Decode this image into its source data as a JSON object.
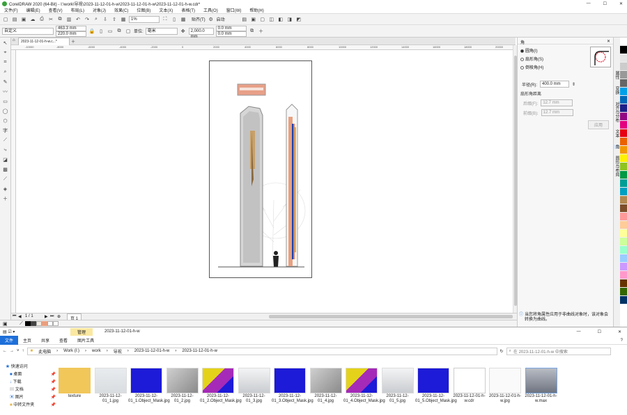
{
  "window": {
    "title": "CorelDRAW 2020 (64-Bit) - I:\\work\\导视\\2023-11-12-01-h-w\\2023-11-12-01-h-w\\2023-11-12-01-h-w.cdr*"
  },
  "menu": [
    "文件(F)",
    "编辑(E)",
    "查看(V)",
    "布局(L)",
    "对象(J)",
    "效果(C)",
    "位图(B)",
    "文本(X)",
    "表格(T)",
    "工具(O)",
    "窗口(W)",
    "帮助(H)"
  ],
  "toolbar": {
    "zoom": "1%",
    "publish": "贴齐(T)",
    "launch": "启动"
  },
  "propbar": {
    "preset": "自定义",
    "width": "463.3 mm",
    "height": "220.0 mm",
    "units_label": "单位:",
    "units": "毫米",
    "nudge": "2,000.0 mm",
    "dup_x": "0.0 mm",
    "dup_y": "0.0 mm"
  },
  "document": {
    "tab": "2023-11-12-01-h-w.c...*",
    "page_tab": "页 1"
  },
  "ruler_ticks": [
    "-10000",
    "-8000",
    "-6000",
    "-4000",
    "-2000",
    "0",
    "2000",
    "4000",
    "6000",
    "8000",
    "10000",
    "12000",
    "14000",
    "16000",
    "18000",
    "20000"
  ],
  "panel": {
    "header": "角",
    "option_round": "圆角(I)",
    "option_scallop": "扇形角(S)",
    "option_chamfer": "倒棱角(H)",
    "radius_label": "半径(R):",
    "radius_value": "400.0 mm",
    "corner_distance": "扇形角距离",
    "offset_label": "后缀(F):",
    "offset_value": "12.7 mm",
    "offset2_label": "前缀(B):",
    "offset2_value": "12.7 mm",
    "apply": "应用",
    "note": "当您将角属性应用于非曲线对象时，该对象会转换为曲线。"
  },
  "right_tabs": [
    "属性",
    "变换",
    "对齐与分布",
    "文本",
    "角",
    "图形与布局"
  ],
  "palette_colors": [
    "#ffffff",
    "#000000",
    "#e5e5e5",
    "#cccccc",
    "#999999",
    "#666666",
    "#00a0e9",
    "#0068b7",
    "#1d2088",
    "#920783",
    "#e4007f",
    "#e60012",
    "#eb6100",
    "#f39800",
    "#fff100",
    "#8fc31f",
    "#009944",
    "#009e96",
    "#00a0c1",
    "#b28850",
    "#7d4e2a",
    "#ff9999",
    "#ffcc99",
    "#ffff99",
    "#ccff99",
    "#99ffcc",
    "#99ccff",
    "#cc99ff",
    "#ff99cc",
    "#663300",
    "#336600",
    "#003366"
  ],
  "explorer": {
    "ribbon_tabs": [
      "文件",
      "主页",
      "共享",
      "查看"
    ],
    "manage_tab": "管理",
    "picture_tools": "图片工具",
    "title": "2023-11-12-01-h-w",
    "breadcrumb": [
      "此电脑",
      "Work (I:)",
      "work",
      "导视",
      "2023-11-12-01-h-w",
      "2023-11-12-01-h-w"
    ],
    "search_placeholder": "在 2023-11-12-01-h-w 中搜索",
    "quick_access": "快速访问",
    "sidebar": [
      "桌面",
      "下载",
      "文档",
      "图片",
      "中转文件夹"
    ],
    "files": [
      "texture",
      "2023-11-12-01_1.jpg",
      "2023-11-12-01_1.Object_Mask.jpg",
      "2023-11-12-01_2.jpg",
      "2023-11-12-01_2.Object_Mask.jpg",
      "2023-11-12-01_3.jpg",
      "2023-11-12-01_3.Object_Mask.jpg",
      "2023-11-12-01_4.jpg",
      "2023-11-12-01_4.Object_Mask.jpg",
      "2023-11-12-01_5.jpg",
      "2023-11-12-01_5.Object_Mask.jpg",
      "2023-11-12-01-h-w.cdr",
      "2023-11-12-01-h-w.jpg",
      "2023-11-12-01-h-w.max"
    ]
  }
}
